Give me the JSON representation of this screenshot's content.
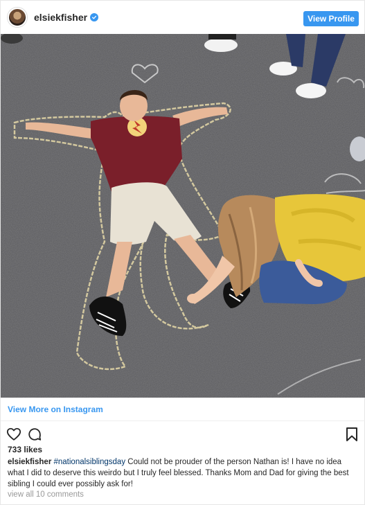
{
  "post": {
    "username": "elsiekfisher",
    "verified": true,
    "view_profile_label": "View Profile",
    "view_more_label": "View More on Instagram",
    "likes": "733 likes",
    "caption_user": "elsiekfisher",
    "caption_hashtag": "#nationalsiblingsday",
    "caption_text": " Could not be prouder of the person Nathan is! I have no idea what I did to deserve this weirdo but I truly feel blessed. Thanks Mom and Dad for giving the best sibling I could ever possibly ask for!",
    "comments_label": "view all 10 comments"
  },
  "icons": {
    "verified": "verified-check-icon",
    "like": "heart-icon",
    "comment": "comment-bubble-icon",
    "save": "bookmark-icon"
  },
  "colors": {
    "accent": "#3897f0",
    "text": "#262626",
    "muted": "#999999",
    "hashtag": "#003569"
  }
}
